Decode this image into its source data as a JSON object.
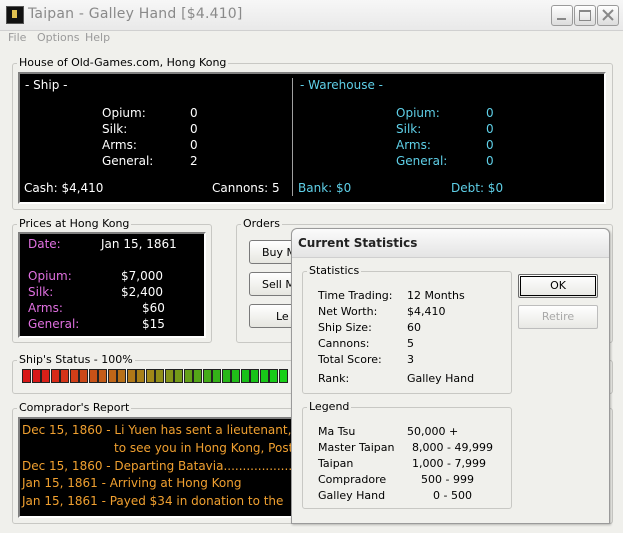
{
  "window": {
    "title": "Taipan - Galley Hand [$4.410]"
  },
  "menu": [
    "File",
    "Options",
    "Help"
  ],
  "house": {
    "label": "House of Old-Games.com, Hong Kong",
    "ship": {
      "header": "- Ship -",
      "items": [
        {
          "name": "Opium:",
          "value": "0"
        },
        {
          "name": "Silk:",
          "value": "0"
        },
        {
          "name": "Arms:",
          "value": "0"
        },
        {
          "name": "General:",
          "value": "2"
        }
      ],
      "cash": "Cash: $4,410",
      "cannons": "Cannons:  5"
    },
    "warehouse": {
      "header": "- Warehouse -",
      "items": [
        {
          "name": "Opium:",
          "value": "0"
        },
        {
          "name": "Silk:",
          "value": "0"
        },
        {
          "name": "Arms:",
          "value": "0"
        },
        {
          "name": "General:",
          "value": "0"
        }
      ],
      "bank": "Bank: $0",
      "debt": "Debt: $0"
    }
  },
  "prices": {
    "label": "Prices at Hong Kong",
    "date_label": "Date:",
    "date": "Jan 15, 1861",
    "items": [
      {
        "name": "Opium:",
        "value": "$7,000"
      },
      {
        "name": "Silk:",
        "value": "$2,400"
      },
      {
        "name": "Arms:",
        "value": "$60"
      },
      {
        "name": "General:",
        "value": "$15"
      }
    ]
  },
  "orders": {
    "label": "Orders",
    "buttons": [
      "Buy M",
      "Sell M",
      "Le"
    ]
  },
  "status": {
    "label": "Ship's Status - 100%",
    "percent": 100,
    "bar_colors": [
      "#d81818",
      "#d81818",
      "#d82018",
      "#d82a18",
      "#d43418",
      "#d03e18",
      "#cc4818",
      "#c85218",
      "#c45c18",
      "#c06618",
      "#b87018",
      "#b07818",
      "#a88018",
      "#a08818",
      "#908e18",
      "#849418",
      "#749a18",
      "#64a018",
      "#54a618",
      "#44ac18",
      "#34b218",
      "#28b818",
      "#20bc18",
      "#18c018",
      "#18c418",
      "#18c818",
      "#18cc18",
      "#18d018"
    ]
  },
  "comprador": {
    "label": "Comprador's Report",
    "lines": [
      {
        "text": "Dec 15, 1860 - Li Yuen has sent a lieutenant,",
        "color": "o"
      },
      {
        "text": "to see you in Hong Kong, Post",
        "color": "o",
        "indent": true
      },
      {
        "text": "Dec 15, 1860 - Departing Batavia.........................",
        "color": "o"
      },
      {
        "text": "Jan 15, 1861 - Arriving at Hong Kong",
        "color": "o"
      },
      {
        "text": "Jan 15, 1861 - Payed $34 in donation to the",
        "color": "o"
      }
    ]
  },
  "dialog": {
    "title": "Current Statistics",
    "stats_label": "Statistics",
    "stats": [
      {
        "name": "Time Trading:",
        "value": "12 Months"
      },
      {
        "name": "Net Worth:",
        "value": "$4,410"
      },
      {
        "name": "Ship Size:",
        "value": "60"
      },
      {
        "name": "Cannons:",
        "value": "5"
      },
      {
        "name": "Total Score:",
        "value": "3"
      },
      {
        "name": "Rank:",
        "value": "Galley Hand"
      }
    ],
    "legend_label": "Legend",
    "legend": [
      {
        "name": "Ma Tsu",
        "value": "50,000 +"
      },
      {
        "name": "Master Taipan",
        "value": "8,000 - 49,999"
      },
      {
        "name": "Taipan",
        "value": "1,000 - 7,999"
      },
      {
        "name": "Compradore",
        "value": "500 - 999"
      },
      {
        "name": "Galley Hand",
        "value": "0 - 500"
      }
    ],
    "ok_label": "OK",
    "retire_label": "Retire"
  }
}
